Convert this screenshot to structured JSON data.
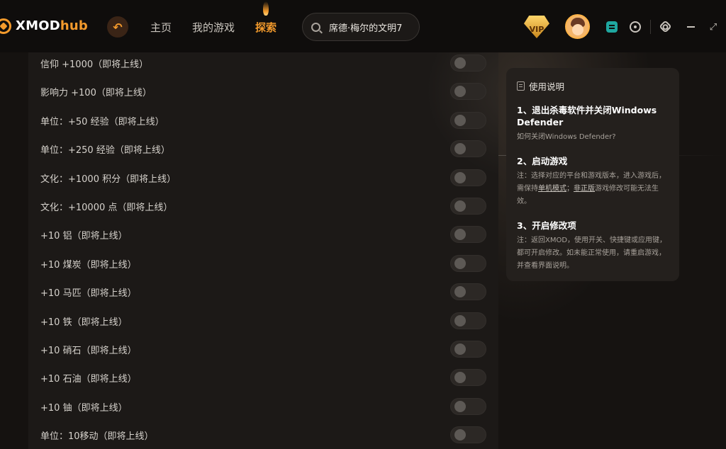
{
  "app": {
    "logo_main": "XMOD",
    "logo_accent": "hub"
  },
  "nav": {
    "back_glyph": "↶",
    "items": [
      {
        "label": "主页",
        "active": false
      },
      {
        "label": "我的游戏",
        "active": false
      },
      {
        "label": "探索",
        "active": true
      }
    ]
  },
  "search": {
    "value": "席德·梅尔的文明7",
    "icon": "search-icon"
  },
  "header_right": {
    "vip_label": "VIP",
    "max_glyph": "⤢"
  },
  "mods": [
    {
      "label": "信仰 +1000（即将上线）",
      "enabled": false
    },
    {
      "label": "影响力 +100（即将上线）",
      "enabled": false
    },
    {
      "label": "单位：+50 经验（即将上线）",
      "enabled": false
    },
    {
      "label": "单位：+250 经验（即将上线）",
      "enabled": false
    },
    {
      "label": "文化：+1000 积分（即将上线）",
      "enabled": false
    },
    {
      "label": "文化：+10000 点（即将上线）",
      "enabled": false
    },
    {
      "label": "+10 铝（即将上线）",
      "enabled": false
    },
    {
      "label": "+10 煤炭（即将上线）",
      "enabled": false
    },
    {
      "label": "+10 马匹（即将上线）",
      "enabled": false
    },
    {
      "label": "+10 铁（即将上线）",
      "enabled": false
    },
    {
      "label": "+10 硝石（即将上线）",
      "enabled": false
    },
    {
      "label": "+10 石油（即将上线）",
      "enabled": false
    },
    {
      "label": "+10 铀（即将上线）",
      "enabled": false
    },
    {
      "label": "单位：10移动（即将上线）",
      "enabled": false
    }
  ],
  "help": {
    "title": "使用说明",
    "step1_title": "1、退出杀毒软件并关闭Windows Defender",
    "step1_link": "如何关闭Windows Defender?",
    "step2_title": "2、启动游戏",
    "step2_note_a": "注：选择对应的平台和游戏版本，进入游戏后，需保持",
    "step2_note_b": "单机模式",
    "step2_note_c": "；",
    "step2_note_d": "非正版",
    "step2_note_e": "游戏修改可能无法生效。",
    "step3_title": "3、开启修改项",
    "step3_note": "注：返回XMOD，使用开关、快捷键或应用键，都可开启修改。如未能正常使用，请重启游戏，并查看界面说明。"
  },
  "colors": {
    "accent": "#f39a2c",
    "panel": "#1c1917",
    "card": "#24201d"
  }
}
